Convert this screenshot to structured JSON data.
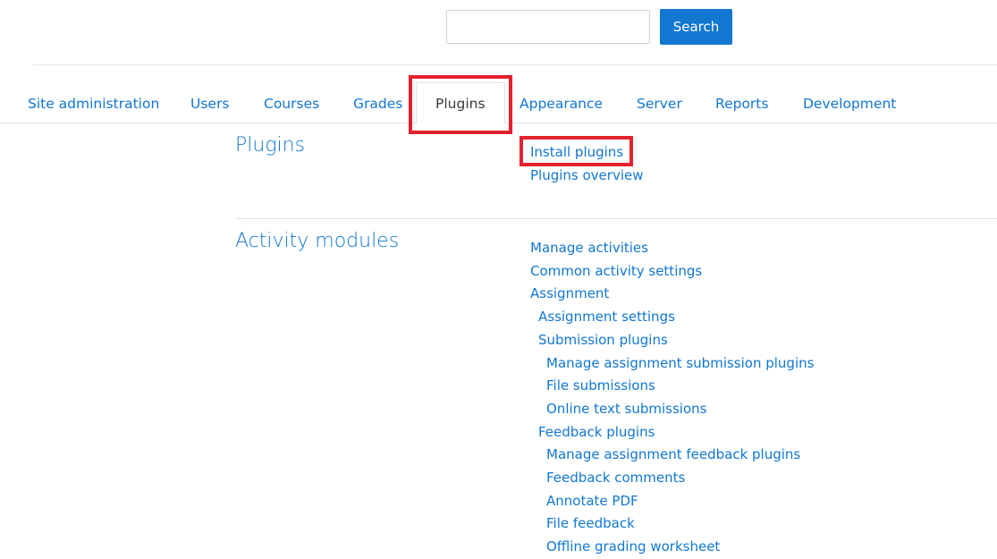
{
  "search": {
    "placeholder": "",
    "value": "",
    "button_label": "Search"
  },
  "tabs": [
    {
      "label": "Site administration",
      "active": false
    },
    {
      "label": "Users",
      "active": false
    },
    {
      "label": "Courses",
      "active": false
    },
    {
      "label": "Grades",
      "active": false
    },
    {
      "label": "Plugins",
      "active": true
    },
    {
      "label": "Appearance",
      "active": false
    },
    {
      "label": "Server",
      "active": false
    },
    {
      "label": "Reports",
      "active": false
    },
    {
      "label": "Development",
      "active": false
    }
  ],
  "sections": [
    {
      "heading": "Plugins",
      "links": [
        {
          "label": "Install plugins",
          "level": 0
        },
        {
          "label": "Plugins overview",
          "level": 0
        }
      ]
    },
    {
      "heading": "Activity modules",
      "links": [
        {
          "label": "Manage activities",
          "level": 0
        },
        {
          "label": "Common activity settings",
          "level": 0
        },
        {
          "label": "Assignment",
          "level": 0
        },
        {
          "label": "Assignment settings",
          "level": 1
        },
        {
          "label": "Submission plugins",
          "level": 1
        },
        {
          "label": "Manage assignment submission plugins",
          "level": 2
        },
        {
          "label": "File submissions",
          "level": 2
        },
        {
          "label": "Online text submissions",
          "level": 2
        },
        {
          "label": "Feedback plugins",
          "level": 1
        },
        {
          "label": "Manage assignment feedback plugins",
          "level": 2
        },
        {
          "label": "Feedback comments",
          "level": 2
        },
        {
          "label": "Annotate PDF",
          "level": 2
        },
        {
          "label": "File feedback",
          "level": 2
        },
        {
          "label": "Offline grading worksheet",
          "level": 2
        }
      ]
    }
  ],
  "colors": {
    "link": "#1177d1",
    "text": "#373a3c",
    "highlight": "#e3212d",
    "button_bg": "#1177d1"
  }
}
